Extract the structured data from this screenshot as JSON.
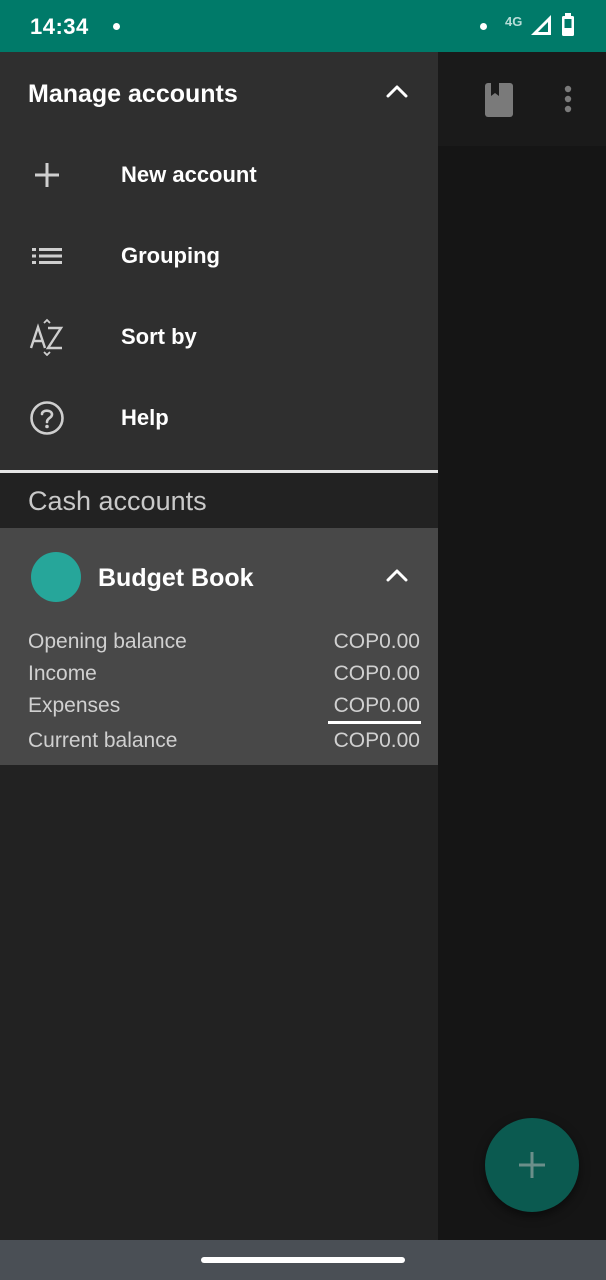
{
  "status_bar": {
    "time": "14:34",
    "network": "4G",
    "bg_color": "#007a69"
  },
  "app_bar": {
    "icons": [
      "book-icon",
      "more-vert-icon"
    ]
  },
  "drawer": {
    "title": "Manage accounts",
    "menu_items": [
      {
        "label": "New account",
        "icon": "plus-icon"
      },
      {
        "label": "Grouping",
        "icon": "list-icon"
      },
      {
        "label": "Sort by",
        "icon": "sort-az-icon"
      },
      {
        "label": "Help",
        "icon": "help-circle-icon"
      }
    ],
    "section_label": "Cash accounts",
    "account": {
      "name": "Budget Book",
      "color": "#26a69a",
      "rows": [
        {
          "label": "Opening balance",
          "value": "COP0.00"
        },
        {
          "label": "Income",
          "value": "COP0.00"
        },
        {
          "label": "Expenses",
          "value": "COP0.00"
        },
        {
          "label": "Current balance",
          "value": "COP0.00"
        }
      ]
    }
  },
  "fab": {
    "icon": "plus-icon",
    "color": "#0b5a50"
  }
}
